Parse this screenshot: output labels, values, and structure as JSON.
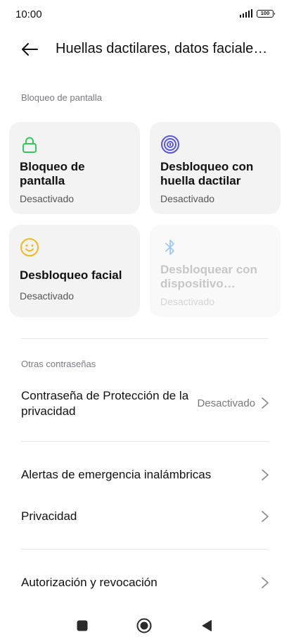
{
  "status_bar": {
    "time": "10:00",
    "battery": "100"
  },
  "header": {
    "title": "Huellas dactilares, datos faciales y contraseña",
    "back_icon": "arrow-left-icon"
  },
  "screen_lock_section": {
    "label": "Bloqueo de pantalla",
    "cards": [
      {
        "title": "Bloqueo de pantalla",
        "status": "Desactivado",
        "icon": "lock-icon",
        "color": "#34c759"
      },
      {
        "title": "Desbloqueo con huella dactilar",
        "status": "Desactivado",
        "icon": "fingerprint-icon",
        "color": "#5b57d6"
      },
      {
        "title": "Desbloqueo facial",
        "status": "Desactivado",
        "icon": "face-icon",
        "color": "#f2b81f"
      },
      {
        "title": "Desbloquear con dispositivo Bluetooth",
        "status": "Desactivado",
        "icon": "bluetooth-icon",
        "color": "#9ccaf5"
      }
    ]
  },
  "other_passwords_section": {
    "label": "Otras contraseñas",
    "privacy_password": {
      "label": "Contraseña de Protección de la privacidad",
      "value": "Desactivado"
    }
  },
  "list_items": {
    "emergency_alerts": "Alertas de emergencia inalámbricas",
    "privacy": "Privacidad",
    "authorization": "Autorización y revocación"
  },
  "nav_bar": {
    "icons": [
      "recents-square-icon",
      "home-circle-icon",
      "back-triangle-icon"
    ]
  }
}
